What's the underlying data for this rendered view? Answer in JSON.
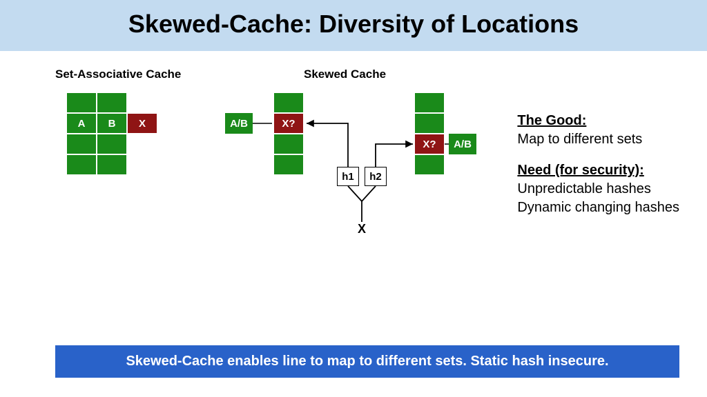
{
  "title": "Skewed-Cache: Diversity of Locations",
  "labels": {
    "set_assoc": "Set-Associative Cache",
    "skewed": "Skewed Cache"
  },
  "cells": {
    "A": "A",
    "B": "B",
    "X": "X",
    "AB": "A/B",
    "Xq": "X?",
    "h1": "h1",
    "h2": "h2",
    "Xin": "X"
  },
  "side": {
    "good_hdr": "The Good:",
    "good_body": "Map to different sets",
    "need_hdr": "Need (for security):",
    "need_line1": "Unpredictable hashes",
    "need_line2": "Dynamic changing hashes"
  },
  "footer": "Skewed-Cache enables line to map to different sets. Static hash insecure."
}
